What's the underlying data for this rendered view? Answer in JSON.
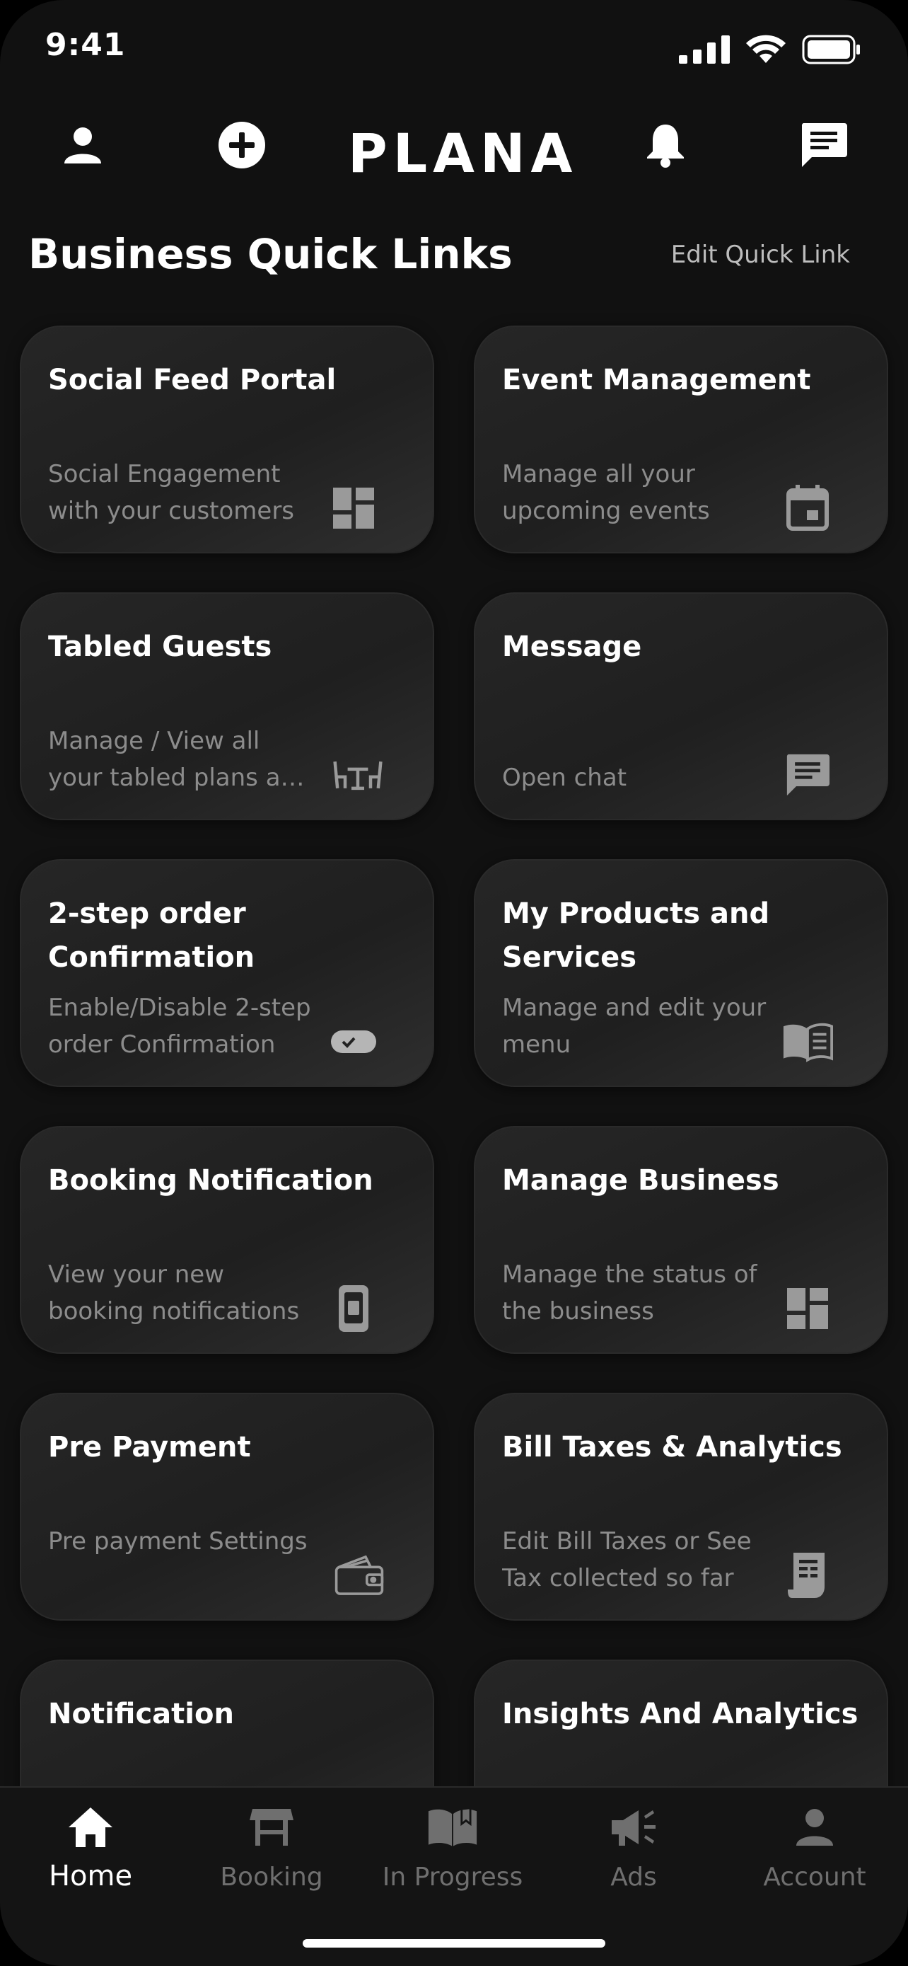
{
  "status": {
    "time": "9:41"
  },
  "header": {
    "logo": "PLANA",
    "title": "Business Quick Links",
    "edit_label": "Edit Quick Link"
  },
  "cards": [
    {
      "title": "Social Feed Portal",
      "desc": "Social Engagement with your customers",
      "icon": "dashboard-icon"
    },
    {
      "title": "Event Management",
      "desc": "Manage all your upcoming events",
      "icon": "calendar-icon"
    },
    {
      "title": "Tabled Guests",
      "desc": "Manage / View all your tabled plans and guests",
      "icon": "table-chairs-icon"
    },
    {
      "title": "Message",
      "desc": "Open chat",
      "icon": "chat-icon"
    },
    {
      "title": "2-step order Confirmation",
      "desc": "Enable/Disable 2-step order Confirmation",
      "icon": "toggle-icon"
    },
    {
      "title": "My Products and Services",
      "desc": "Manage and edit your menu",
      "icon": "menu-book-icon"
    },
    {
      "title": "Booking Notification",
      "desc": "View your new booking notifications",
      "icon": "phone-icon"
    },
    {
      "title": "Manage Business",
      "desc": "Manage the status of the business",
      "icon": "dashboard-icon"
    },
    {
      "title": "Pre Payment",
      "desc": "Pre payment Settings",
      "icon": "wallet-icon"
    },
    {
      "title": "Bill Taxes & Analytics",
      "desc": "Edit Bill Taxes or See Tax collected so far",
      "icon": "receipt-icon"
    },
    {
      "title": "Notification",
      "desc": "",
      "icon": ""
    },
    {
      "title": "Insights And Analytics",
      "desc": "",
      "icon": ""
    }
  ],
  "tabs": [
    {
      "label": "Home",
      "icon": "home-icon",
      "active": true
    },
    {
      "label": "Booking",
      "icon": "booking-table-icon",
      "active": false
    },
    {
      "label": "In Progress",
      "icon": "book-open-icon",
      "active": false
    },
    {
      "label": "Ads",
      "icon": "megaphone-icon",
      "active": false
    },
    {
      "label": "Account",
      "icon": "person-icon",
      "active": false
    }
  ],
  "colors": {
    "background": "#111111",
    "card": "#232323",
    "text": "#ffffff",
    "muted": "#8c8c8c",
    "tab_inactive": "#6f6f6f"
  }
}
